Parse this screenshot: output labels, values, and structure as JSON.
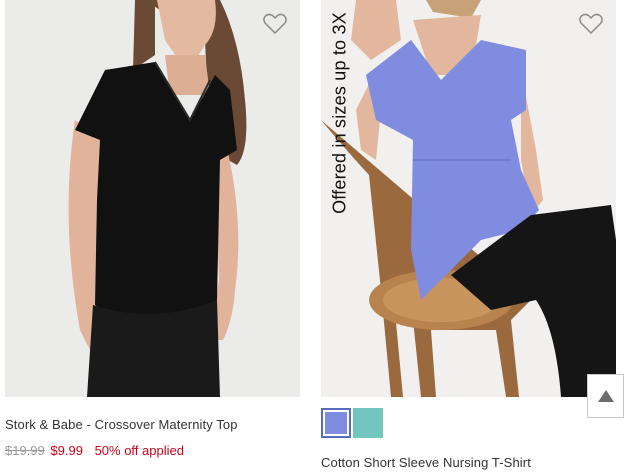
{
  "products": [
    {
      "name": "Stork & Babe - Crossover Maternity Top",
      "price_original": "$19.99",
      "price_sale": "$9.99",
      "discount_text": "50% off applied",
      "favorite_icon": "heart-outline-icon"
    },
    {
      "name": "Cotton Short Sleeve Nursing T-Shirt",
      "badge_text": "Offered in sizes up to 3X",
      "favorite_icon": "heart-outline-icon",
      "swatches": [
        {
          "color": "#7f8ce0",
          "selected": true
        },
        {
          "color": "#72c6bf",
          "selected": false
        }
      ]
    }
  ],
  "scroll_top_icon": "triangle-up-icon"
}
